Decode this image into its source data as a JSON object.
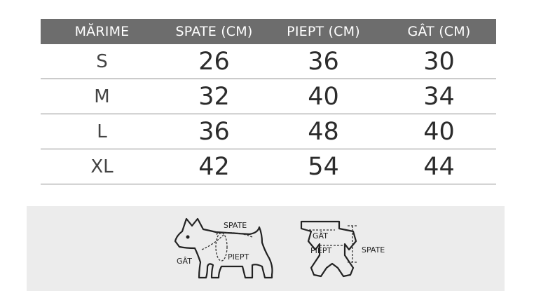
{
  "table": {
    "headers": [
      "MĂRIME",
      "SPATE (CM)",
      "PIEPT (CM)",
      "GÂT (CM)"
    ],
    "rows": [
      [
        "S",
        "26",
        "36",
        "30"
      ],
      [
        "M",
        "32",
        "40",
        "34"
      ],
      [
        "L",
        "36",
        "48",
        "40"
      ],
      [
        "XL",
        "42",
        "54",
        "44"
      ]
    ]
  },
  "guide": {
    "dog": {
      "back_label": "SPATE",
      "chest_label": "PIEPT",
      "neck_label": "GÂT"
    },
    "garment": {
      "neck_label": "GÂT",
      "chest_label": "PIEPT",
      "back_label": "SPATE"
    }
  }
}
